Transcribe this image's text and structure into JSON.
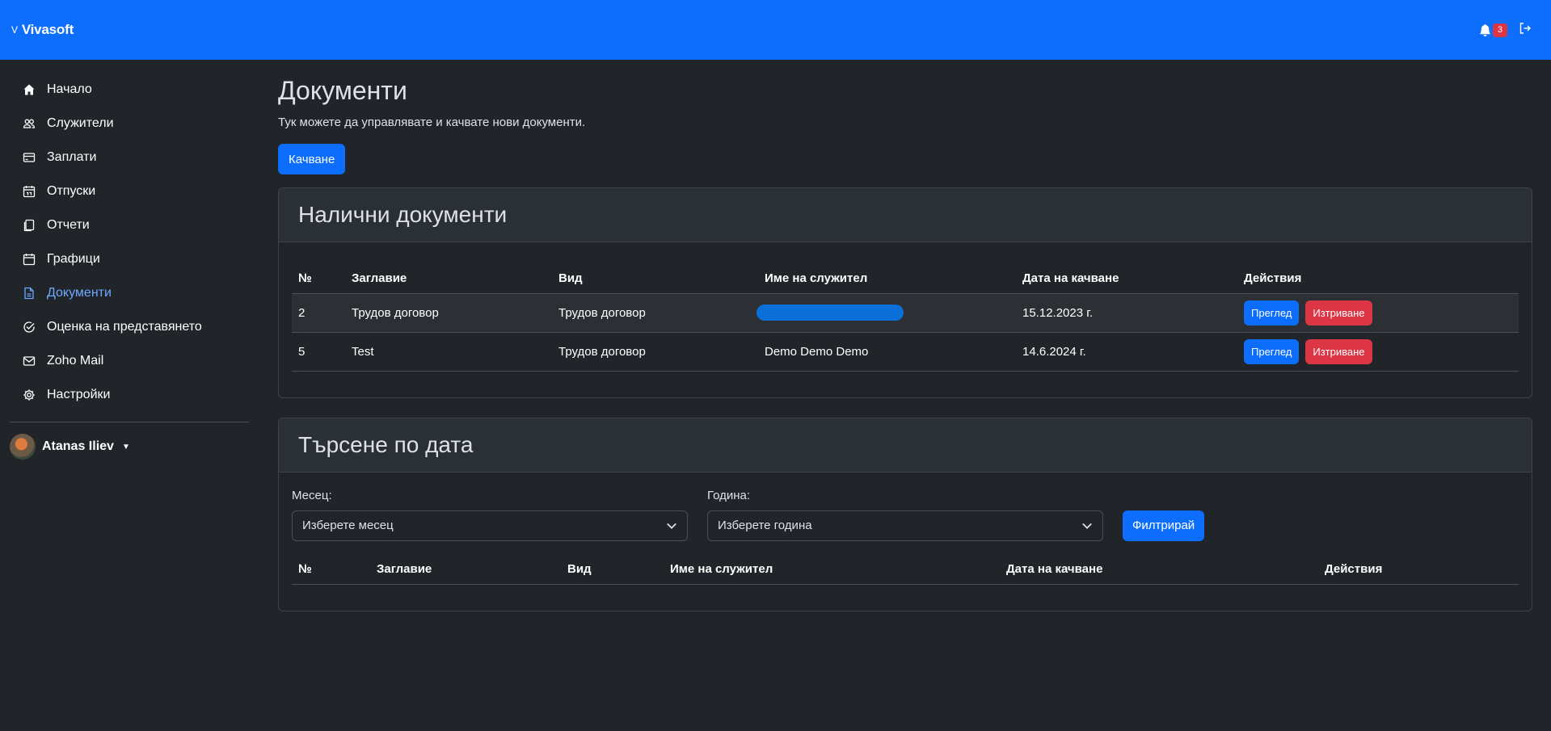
{
  "brand": {
    "prefix": "V",
    "name": "Vivasoft"
  },
  "header": {
    "notification_count": "3"
  },
  "sidebar": {
    "items": [
      {
        "label": "Начало"
      },
      {
        "label": "Служители"
      },
      {
        "label": "Заплати"
      },
      {
        "label": "Отпуски"
      },
      {
        "label": "Отчети"
      },
      {
        "label": "Графици"
      },
      {
        "label": "Документи"
      },
      {
        "label": "Оценка на представянето"
      },
      {
        "label": "Zoho Mail"
      },
      {
        "label": "Настройки"
      }
    ],
    "user": {
      "name": "Atanas Iliev"
    }
  },
  "main": {
    "title": "Документи",
    "subtitle": "Тук можете да управлявате и качвате нови документи.",
    "upload_label": "Качване",
    "available": {
      "title": "Налични документи",
      "columns": [
        "№",
        "Заглавие",
        "Вид",
        "Име на служител",
        "Дата на качване",
        "Действия"
      ],
      "rows": [
        {
          "no": "2",
          "title": "Трудов договор",
          "type": "Трудов договор",
          "employee": "",
          "date": "15.12.2023 г.",
          "view": "Преглед",
          "delete": "Изтриване"
        },
        {
          "no": "5",
          "title": "Test",
          "type": "Трудов договор",
          "employee": "Demo Demo Demo",
          "date": "14.6.2024 г.",
          "view": "Преглед",
          "delete": "Изтриване"
        }
      ]
    },
    "search": {
      "title": "Търсене по дата",
      "month_label": "Месец:",
      "month_value": "Изберете месец",
      "year_label": "Година:",
      "year_value": "Изберете година",
      "filter_label": "Филтрирай",
      "columns": [
        "№",
        "Заглавие",
        "Вид",
        "Име на служител",
        "Дата на качване",
        "Действия"
      ]
    }
  },
  "colors": {
    "primary": "#0d6efd",
    "danger": "#dc3545",
    "background": "#212529",
    "active_link": "#6ea8fe"
  }
}
